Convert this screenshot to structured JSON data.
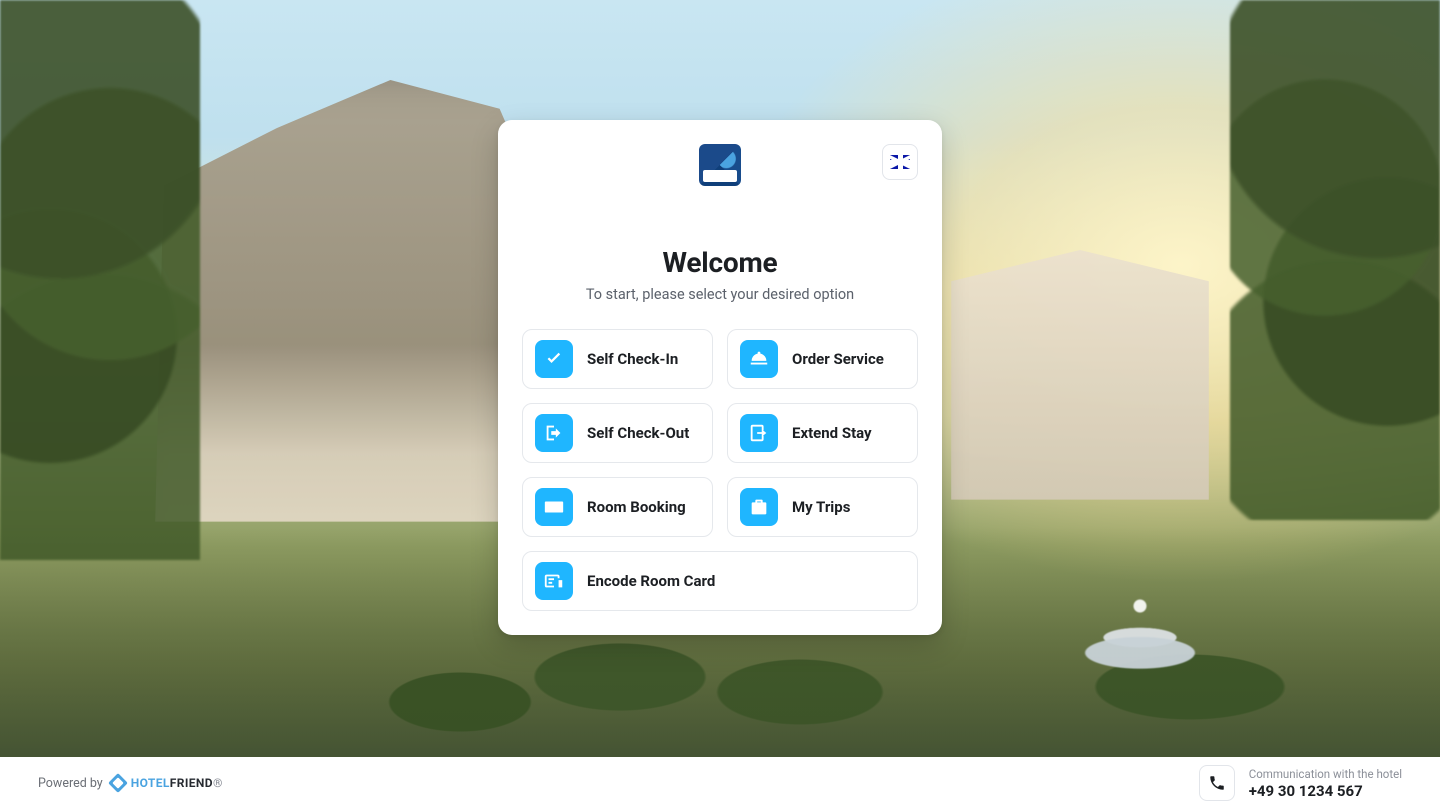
{
  "language": {
    "name": "English (UK)",
    "flag": "uk"
  },
  "welcome": {
    "title": "Welcome",
    "subtitle": "To start, please select your desired option"
  },
  "options": {
    "checkin": {
      "label": "Self Check-In",
      "icon": "check-icon"
    },
    "order": {
      "label": "Order Service",
      "icon": "bell-icon"
    },
    "checkout": {
      "label": "Self Check-Out",
      "icon": "exit-icon"
    },
    "extend": {
      "label": "Extend Stay",
      "icon": "extend-icon"
    },
    "booking": {
      "label": "Room Booking",
      "icon": "keyboard-icon"
    },
    "trips": {
      "label": "My Trips",
      "icon": "suitcase-icon"
    },
    "encode": {
      "label": "Encode Room Card",
      "icon": "card-icon"
    }
  },
  "footer": {
    "powered_by": "Powered by",
    "brand_a": "HOTEL",
    "brand_b": "FRIEND",
    "contact_label": "Communication with the hotel",
    "phone": "+49 30 1234 567"
  }
}
